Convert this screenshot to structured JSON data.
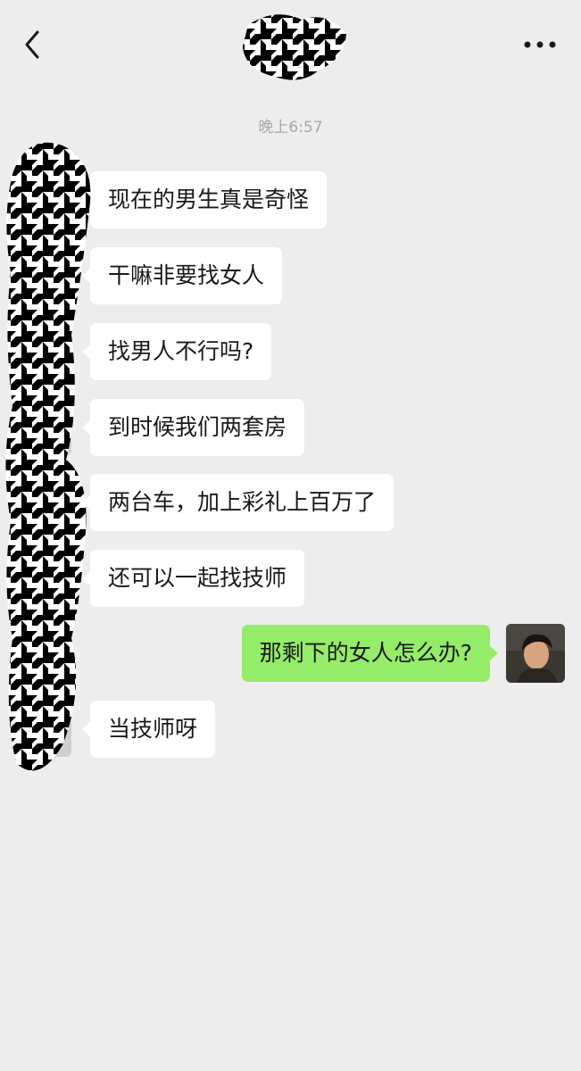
{
  "header": {
    "back_icon": "chevron-left-icon",
    "more_icon": "more-dots-icon"
  },
  "timestamp": "晚上6:57",
  "messages": [
    {
      "side": "left",
      "text": "现在的男生真是奇怪"
    },
    {
      "side": "left",
      "text": "干嘛非要找女人"
    },
    {
      "side": "left",
      "text": "找男人不行吗?"
    },
    {
      "side": "left",
      "text": "到时候我们两套房"
    },
    {
      "side": "left",
      "text": "两台车，加上彩礼上百万了"
    },
    {
      "side": "left",
      "text": "还可以一起找技师"
    },
    {
      "side": "right",
      "text": "那剩下的女人怎么办?"
    },
    {
      "side": "left",
      "text": "当技师呀"
    }
  ],
  "colors": {
    "background": "#ededed",
    "incoming_bubble": "#ffffff",
    "outgoing_bubble": "#95ec69",
    "timestamp_text": "#a8a8a8"
  }
}
